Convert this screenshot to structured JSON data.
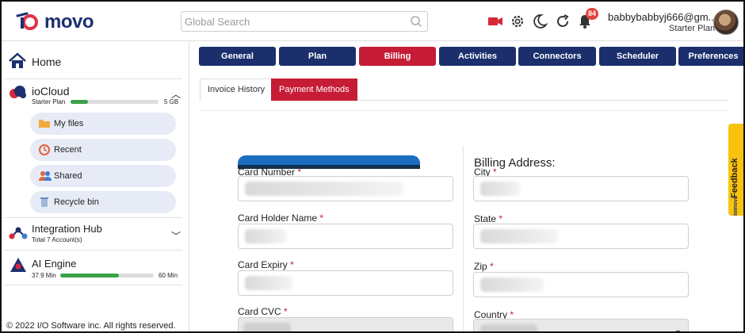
{
  "header": {
    "logo_text": "movo",
    "search_placeholder": "Global Search",
    "notification_count": "84",
    "user_email": "babbybabbyj666@gm...",
    "user_plan": "Starter Plan"
  },
  "sidebar": {
    "home_label": "Home",
    "iocloud": {
      "title": "ioCloud",
      "plan": "Starter Plan",
      "storage_size": "5 GB",
      "storage_used_fraction": 0.2
    },
    "sub_items": [
      {
        "label": "My files",
        "icon": "folder-icon"
      },
      {
        "label": "Recent",
        "icon": "recent-icon"
      },
      {
        "label": "Shared",
        "icon": "shared-icon"
      },
      {
        "label": "Recycle bin",
        "icon": "recycle-bin-icon"
      }
    ],
    "integration_hub": {
      "title": "Integration Hub",
      "subtitle": "Total 7 Account(s)"
    },
    "ai_engine": {
      "title": "AI Engine",
      "used": "37.9 Min",
      "total": "60 Min",
      "used_fraction": 0.63
    },
    "copyright": "© 2022 I/O Software inc. All rights reserved."
  },
  "tabs": [
    "General",
    "Plan",
    "Billing",
    "Activities",
    "Connectors",
    "Scheduler",
    "Preferences"
  ],
  "active_tab": "Billing",
  "subtabs": [
    "Invoice History",
    "Payment Methods"
  ],
  "active_subtab": "Payment Methods",
  "form": {
    "billing_address_title": "Billing Address:",
    "card_number_label": "Card Number",
    "card_holder_label": "Card Holder Name",
    "card_expiry_label": "Card Expiry",
    "card_cvc_label": "Card CVC",
    "city_label": "City",
    "state_label": "State",
    "zip_label": "Zip",
    "country_label": "Country",
    "required_mark": "*"
  },
  "feedback_label": "Feedback",
  "feedback_logo": "iomovo",
  "colors": {
    "navy": "#1a2f6c",
    "accent_red": "#c61c36",
    "progress_green": "#3aa14a",
    "feedback_yellow": "#f8c20e",
    "badge_red": "#e8413f"
  }
}
